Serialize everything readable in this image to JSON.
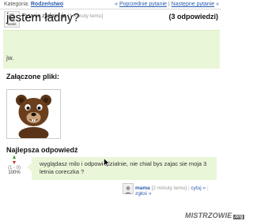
{
  "header": {
    "category_label": "Kategoria:",
    "category_value": "Rodzeństwo",
    "nav_prefix": "«",
    "prev_label": "Poprzednie pytanie",
    "nav_sep": "|",
    "next_label": "Następne pytanie",
    "nav_suffix": "»"
  },
  "question": {
    "asker_label": "Pytanie zadaje:",
    "asker_name": "ja",
    "time": "[1 minuty temu]",
    "answer_count": "(3 odpowiedzi)",
    "title": "jestem ładny?",
    "description": "jw.",
    "attachments_label": "Załączone pliki:",
    "avatar_text": "GOŚĆ"
  },
  "best_answer": {
    "heading": "Najlepsza odpowiedź",
    "votes": "(1 - 0)",
    "percent": "100%",
    "text": "wyglądasz milo i odpowiedzialnie, nie chial bys zajac sie moja 3 letnia coreczka ?",
    "author": "mama",
    "time": "[2 minuty temu]",
    "quote_label": "cytuj »",
    "report_label": "zgłoś »"
  },
  "watermark": {
    "text": "MISTRZOWIE",
    "suffix": ".org"
  }
}
